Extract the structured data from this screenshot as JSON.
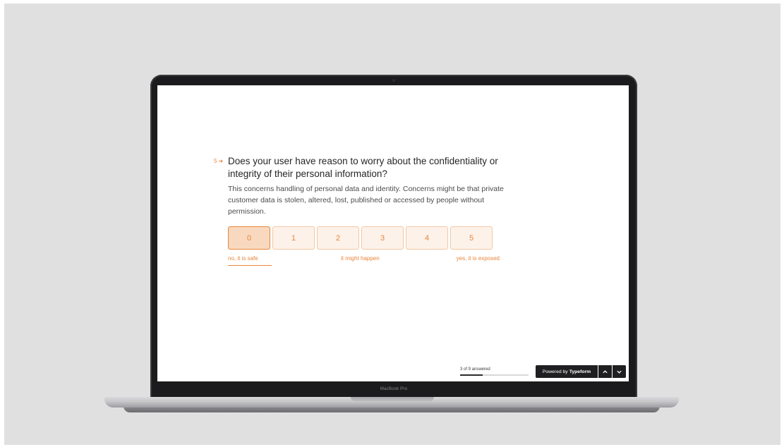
{
  "device": {
    "brand_label": "MacBook Pro"
  },
  "question": {
    "number": "5",
    "arrow_icon": "arrow-right-icon",
    "title": "Does your user have reason to worry about the confidentiality or integrity of their personal information?",
    "description": "This concerns handling of personal data and identity. Concerns might be that private customer data is stolen, altered, lost, published or accessed by people without permission."
  },
  "scale": {
    "options": [
      "0",
      "1",
      "2",
      "3",
      "4",
      "5"
    ],
    "selected": "0",
    "label_left": "no, it is safe",
    "label_mid": "it might happen",
    "label_right": "yes, it is exposed"
  },
  "footer": {
    "progress_text": "3 of 9 answered",
    "progress_fraction": 0.333,
    "powered_prefix": "Powered by",
    "powered_brand": "Typeform",
    "nav_up_icon": "chevron-up-icon",
    "nav_down_icon": "chevron-down-icon"
  },
  "colors": {
    "accent": "#e8853b",
    "option_bg": "#fdf2ea",
    "option_selected_bg": "#f8d9bf",
    "footer_dark": "#1f1f21"
  }
}
